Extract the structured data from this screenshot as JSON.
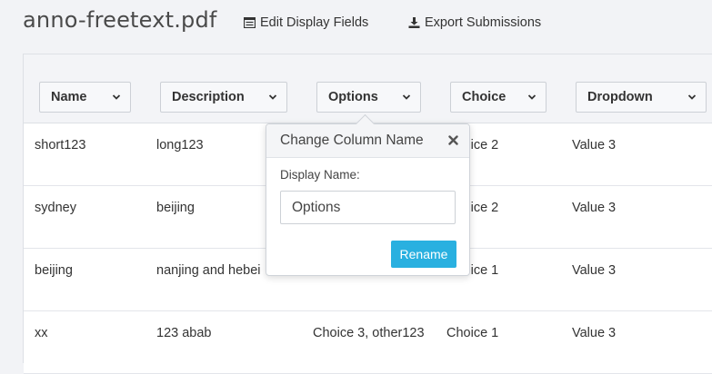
{
  "file": {
    "title": "anno-freetext.pdf"
  },
  "toolbar": {
    "edit_fields": {
      "label": "Edit Display Fields",
      "icon": "list-icon"
    },
    "export": {
      "label": "Export Submissions",
      "icon": "download-icon"
    }
  },
  "columns": [
    {
      "label": "Name"
    },
    {
      "label": "Description"
    },
    {
      "label": "Options"
    },
    {
      "label": "Choice"
    },
    {
      "label": "Dropdown"
    }
  ],
  "rows": [
    {
      "name": "short123",
      "description": "long123",
      "options": "",
      "choice": "Choice 2",
      "dropdown": "Value 3"
    },
    {
      "name": "sydney",
      "description": "beijing",
      "options": "",
      "choice": "Choice 2",
      "dropdown": "Value 3"
    },
    {
      "name": "beijing",
      "description": "nanjing and hebei",
      "options": "",
      "choice": "Choice 1",
      "dropdown": "Value 3"
    },
    {
      "name": "xx",
      "description": "123 abab",
      "options": "Choice 3, other123",
      "choice": "Choice 1",
      "dropdown": "Value 3"
    }
  ],
  "popover": {
    "title": "Change Column Name",
    "field_label": "Display Name:",
    "field_value": "Options",
    "button_label": "Rename"
  },
  "colors": {
    "accent": "#29b0e0",
    "background": "#f2f3f6"
  }
}
